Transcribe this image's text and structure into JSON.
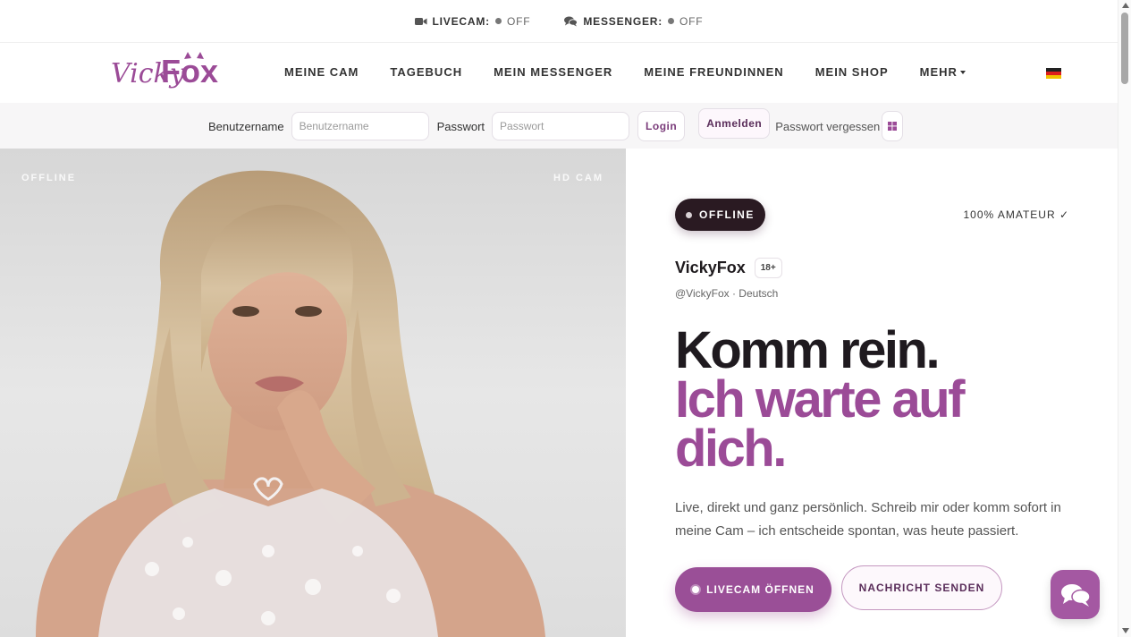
{
  "statusbar": {
    "livecam": {
      "label": "LIVECAM:",
      "state": "OFF",
      "icon": "video-camera-icon"
    },
    "messenger": {
      "label": "MESSENGER:",
      "state": "OFF",
      "icon": "chat-bubbles-icon"
    }
  },
  "brand": {
    "name_part1": "Vicky",
    "name_part2": "Fox",
    "accent": "#9b4b97"
  },
  "nav": {
    "items": [
      "MEINE CAM",
      "TAGEBUCH",
      "MEIN MESSENGER",
      "MEINE FREUNDINNEN",
      "MEIN SHOP",
      "MEHR"
    ],
    "language_flag": "german-flag-icon"
  },
  "login": {
    "username_label": "Benutzername",
    "username_placeholder": "Benutzername",
    "password_label": "Passwort",
    "password_placeholder": "Passwort",
    "login_button": "Login",
    "register_button": "Anmelden",
    "forgot_password": "Passwort vergessen",
    "windows_icon": "windows-icon"
  },
  "hero_image": {
    "badge_left": "OFFLINE",
    "badge_right": "HD CAM"
  },
  "profile": {
    "status": "OFFLINE",
    "amateur_badge": "100% AMATEUR ✓",
    "name": "VickyFox",
    "age_badge": "18+",
    "handle": "@VickyFox · Deutsch",
    "headline_dark": "Komm rein.",
    "headline_purple_1": "Ich warte auf",
    "headline_purple_2": "dich.",
    "description": "Live, direkt und ganz persönlich. Schreib mir oder komm sofort in meine Cam – ich entscheide spontan, was heute passiert.",
    "cta_livecam": "LIVECAM ÖFFNEN",
    "cta_message": "NACHRICHT SENDEN"
  },
  "chat_fab": {
    "icon": "chat-icon"
  }
}
